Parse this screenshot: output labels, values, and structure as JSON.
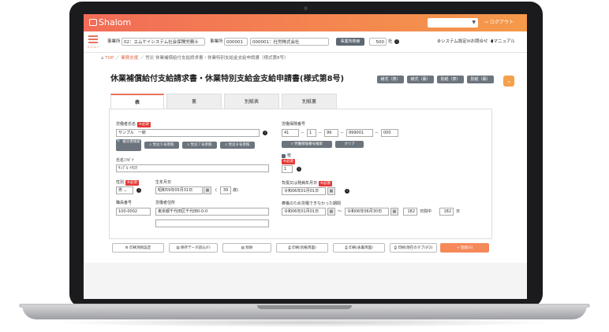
{
  "app": {
    "name": "Shalom",
    "logout": "ログアウト",
    "top_select_value": ""
  },
  "toolbar": {
    "menu_label": "メニュー",
    "office_label": "事業所",
    "office_value": "02：エムケイシステム社会保険労務士",
    "business_label": "事業所",
    "business_code": "000001",
    "business_name": "000001：社労株式会社",
    "search_button": "事業所検索",
    "count_value": "500",
    "count_unit": "社",
    "system_settings": "システム設定",
    "contact": "お問合せ",
    "manual": "マニュアル"
  },
  "breadcrumb": {
    "home": "TOP",
    "business": "業務支援",
    "category": "労災",
    "current": "休業補償給付支給請求書・休業特別支給金支給申請書（様式第8号）"
  },
  "page": {
    "title": "休業補償給付支給請求書・休業特別支給金支給申請書(様式第8号)"
  },
  "sample_buttons": [
    "様式（表）",
    "様式（裏）",
    "別紙（表）",
    "別紙（裏）"
  ],
  "tabs": [
    "表",
    "裏",
    "別紙表",
    "別紙裏"
  ],
  "form": {
    "worker_name_label": "労働者氏名",
    "worker_name_value": "サンプル　一郎",
    "search_worker_btn": "被災者検索",
    "ref5_btn": "労災５号参照",
    "ref7_btn": "労災７号参照",
    "ref8_btn": "労災８号参照",
    "kana_label": "氏名ﾌﾘｶﾞﾅ",
    "kana_value": "ｻﾝﾌﾟﾙ ｲﾁﾛｳ",
    "gender_label": "性別",
    "gender_value": "男",
    "birth_label": "生年月日",
    "birth_value": "昭和59年05月31日",
    "age_value": "39",
    "age_unit": "歳",
    "employee_no_label": "職員番号",
    "employee_no_value": "100-0002",
    "address_label": "労働者住所",
    "address_value": "東京都千代田区千代田0-0-0",
    "address_value2": "",
    "insurance_label": "労働保険番号",
    "ins1": "41",
    "ins2": "1",
    "ins3": "99",
    "ins4": "999001",
    "ins5": "000",
    "ins_search_btn": "労働保険番号検索",
    "clear_btn": "クリア",
    "branch_label": "枝",
    "branch_value": "1",
    "injury_date_label": "負傷又は発病年月日",
    "injury_date_value": "令和06年01月01日",
    "period_label": "療養のため労働できなかった期間",
    "period_from": "令和06年01月01日",
    "period_tilde": "～",
    "period_to": "令和06年06月30日",
    "days_value": "182",
    "days_unit": "日間中",
    "days_value2": "182",
    "days_unit2": "日",
    "required": "※必須"
  },
  "footer": {
    "print_settings": "印刷項目設定",
    "load_saved": "保存データ読込(F)",
    "delete": "削除",
    "print_both": "印刷(別紙両面)",
    "print_face": "印刷(表裏両面)",
    "print_current": "印刷(現在のタブ)(F2)",
    "register": "登録(S)"
  },
  "colors": {
    "accent": "#e8735c",
    "topbar_start": "#f26c57",
    "topbar_end": "#f59a4a",
    "required": "#e53935",
    "button_dark": "#6c757d"
  }
}
